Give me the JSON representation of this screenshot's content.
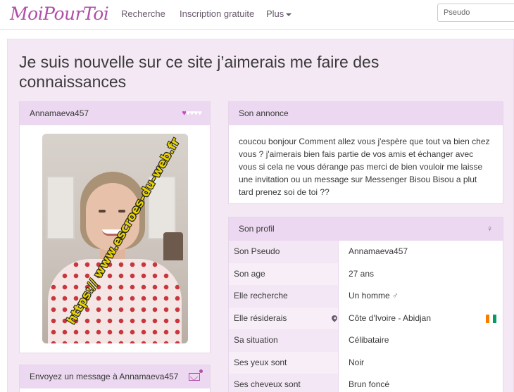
{
  "nav": {
    "logo": "MoiPourToi",
    "links": [
      "Recherche",
      "Inscription gratuite",
      "Plus"
    ],
    "search_placeholder": "Pseudo"
  },
  "page": {
    "title": "Je suis nouvelle sur ce site j’aimerais me faire des connaissances"
  },
  "profile_card": {
    "username": "Annamaeva457",
    "hearts_filled": 1,
    "hearts_total": 5,
    "photo_watermark": "https:// www.escroes-du-web.fr"
  },
  "message_card": {
    "label": "Envoyez un message à Annamaeva457"
  },
  "annonce": {
    "heading": "Son annonce",
    "text": "coucou bonjour Comment allez vous j'espère que tout va bien chez vous ? j'aimerais bien fais partie de vos amis et échanger avec vous si cela ne vous dérange pas merci de bien vouloir me laisse une invitation ou un message sur Messenger Bisou Bisou a plut tard prenez soi de toi ??"
  },
  "profil": {
    "heading": "Son profil",
    "rows": [
      {
        "label": "Son Pseudo",
        "value": "Annamaeva457"
      },
      {
        "label": "Son age",
        "value": "27 ans"
      },
      {
        "label": "Elle recherche",
        "value": "Un homme"
      },
      {
        "label": "Elle résiderais",
        "value": "Côte d'Ivoire - Abidjan"
      },
      {
        "label": "Sa situation",
        "value": "Célibataire"
      },
      {
        "label": "Ses yeux sont",
        "value": "Noir"
      },
      {
        "label": "Ses cheveux sont",
        "value": "Brun foncé"
      }
    ]
  },
  "colors": {
    "brand": "#b04fa8",
    "panel_head": "#ecd8f0",
    "background": "#f4e8f5"
  }
}
